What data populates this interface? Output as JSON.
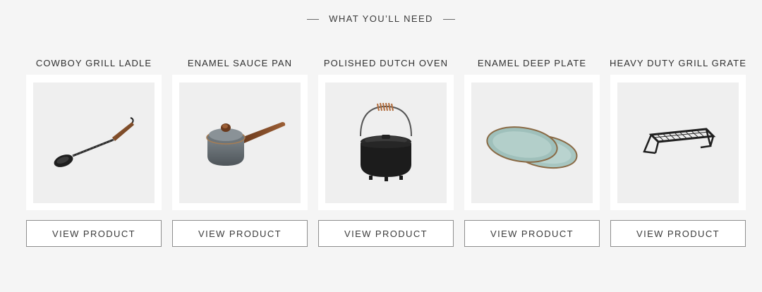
{
  "section": {
    "title": "WHAT YOU’LL NEED"
  },
  "products": [
    {
      "name": "COWBOY GRILL LADLE",
      "button_label": "VIEW PRODUCT",
      "image_icon": "ladle-icon"
    },
    {
      "name": "ENAMEL SAUCE PAN",
      "button_label": "VIEW PRODUCT",
      "image_icon": "sauce-pan-icon"
    },
    {
      "name": "POLISHED DUTCH OVEN",
      "button_label": "VIEW PRODUCT",
      "image_icon": "dutch-oven-icon"
    },
    {
      "name": "ENAMEL DEEP PLATE",
      "button_label": "VIEW PRODUCT",
      "image_icon": "plates-icon"
    },
    {
      "name": "HEAVY DUTY GRILL GRATE",
      "button_label": "VIEW PRODUCT",
      "image_icon": "grill-grate-icon"
    }
  ],
  "colors": {
    "background": "#f5f5f5",
    "card": "#ffffff",
    "image_bg": "#efefef",
    "text": "#333333",
    "border": "#8e8e8e"
  }
}
